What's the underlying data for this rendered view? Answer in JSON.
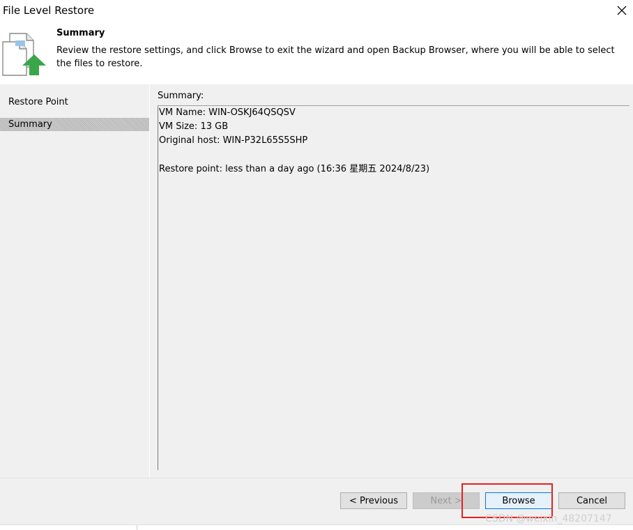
{
  "window": {
    "title": "File Level Restore"
  },
  "header": {
    "title": "Summary",
    "description": "Review the restore settings, and click Browse to exit the wizard and open Backup Browser, where you will be able to select the files to restore."
  },
  "nav": {
    "items": [
      {
        "label": "Restore Point",
        "selected": false
      },
      {
        "label": "Summary",
        "selected": true
      }
    ]
  },
  "summary": {
    "label": "Summary:",
    "lines": [
      "VM Name: WIN-OSKJ64QSQSV",
      "VM Size: 13 GB",
      "Original host: WIN-P32L65S5SHP",
      "",
      "Restore point: less than a day ago (16:36 星期五 2024/8/23)"
    ]
  },
  "buttons": {
    "previous": "< Previous",
    "next": "Next >",
    "browse": "Browse",
    "cancel": "Cancel"
  },
  "watermark": "CSDN @weixin_48207147",
  "colors": {
    "highlight": "#e8201c",
    "accent_green": "#3aa64a",
    "accent_blue": "#0078d7"
  }
}
